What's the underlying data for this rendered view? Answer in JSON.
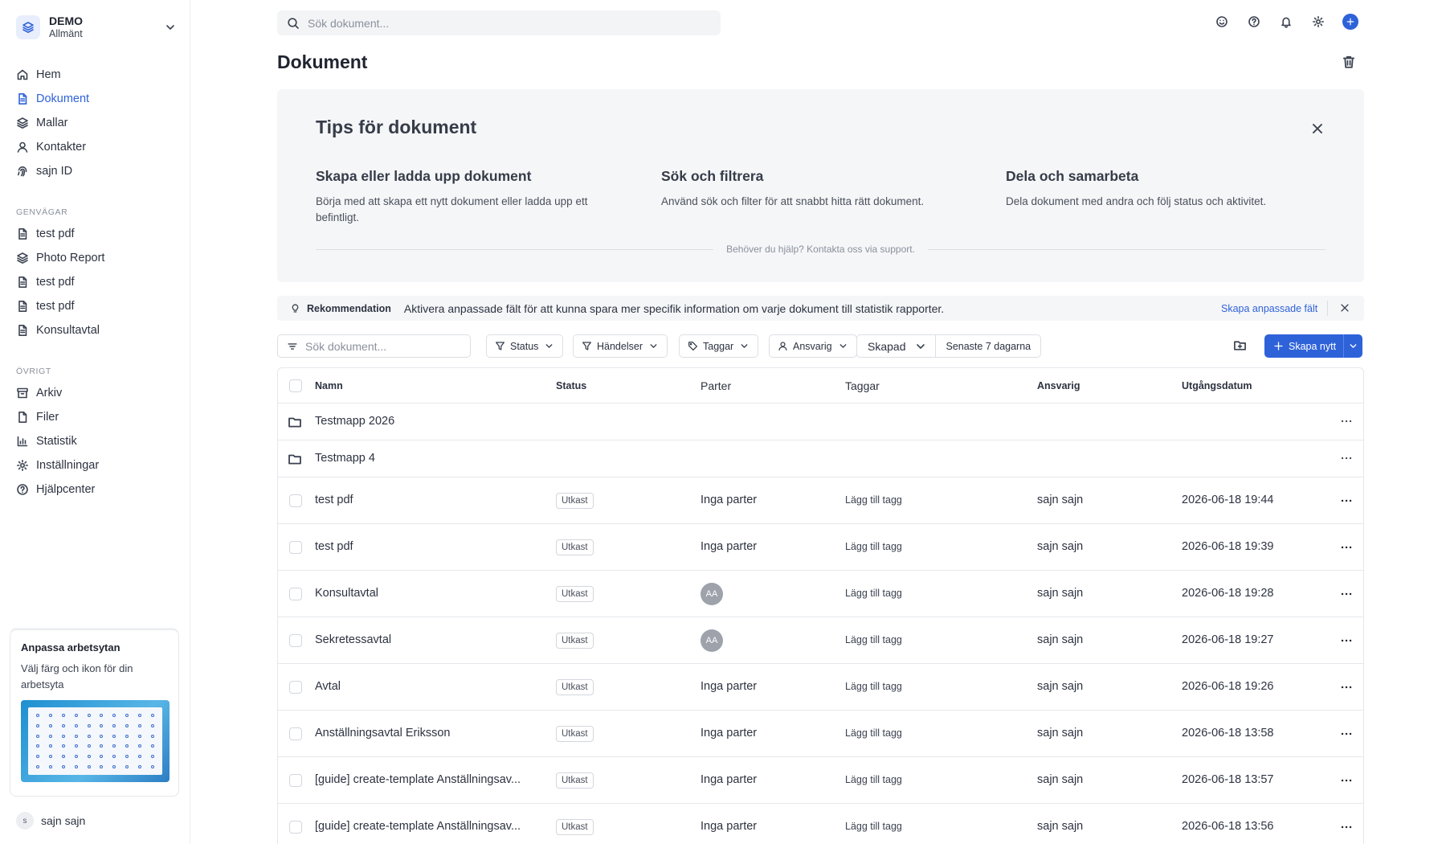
{
  "workspace": {
    "name": "DEMO",
    "subtitle": "Allmänt"
  },
  "nav": [
    {
      "label": "Hem",
      "icon": "home-icon",
      "active": false
    },
    {
      "label": "Dokument",
      "icon": "document-icon",
      "active": true
    },
    {
      "label": "Mallar",
      "icon": "layers-icon",
      "active": false
    },
    {
      "label": "Kontakter",
      "icon": "user-icon",
      "active": false
    },
    {
      "label": "sajn ID",
      "icon": "fingerprint-icon",
      "active": false
    }
  ],
  "shortcuts": {
    "label": "GENVÄGAR",
    "items": [
      {
        "label": "test pdf",
        "icon": "document-icon"
      },
      {
        "label": "Photo Report",
        "icon": "layers-icon"
      },
      {
        "label": "test pdf",
        "icon": "document-icon"
      },
      {
        "label": "test pdf",
        "icon": "document-icon"
      },
      {
        "label": "Konsultavtal",
        "icon": "document-icon"
      }
    ]
  },
  "other": {
    "label": "ÖVRIGT",
    "items": [
      {
        "label": "Arkiv",
        "icon": "archive-icon"
      },
      {
        "label": "Filer",
        "icon": "file-icon"
      },
      {
        "label": "Statistik",
        "icon": "chart-icon"
      },
      {
        "label": "Inställningar",
        "icon": "gear-icon"
      },
      {
        "label": "Hjälpcenter",
        "icon": "help-icon"
      }
    ]
  },
  "promo": {
    "title": "Anpassa arbetsytan",
    "description": "Välj färg och ikon för din arbetsyta"
  },
  "user": {
    "initial": "s",
    "name": "sajn sajn"
  },
  "topbar": {
    "search_placeholder": "Sök dokument..."
  },
  "page": {
    "title": "Dokument"
  },
  "tips": {
    "title": "Tips för dokument",
    "items": [
      {
        "heading": "Skapa eller ladda upp dokument",
        "text": "Börja med att skapa ett nytt dokument eller ladda upp ett befintligt."
      },
      {
        "heading": "Sök och filtrera",
        "text": "Använd sök och filter för att snabbt hitta rätt dokument."
      },
      {
        "heading": "Dela och samarbeta",
        "text": "Dela dokument med andra och följ status och aktivitet."
      }
    ],
    "help": "Behöver du hjälp? Kontakta oss via support."
  },
  "recommendation": {
    "label": "Rekommendation",
    "text": "Aktivera anpassade fält för att kunna spara mer specifik information om varje dokument till statistik rapporter.",
    "link": "Skapa anpassade fält"
  },
  "filters": {
    "search_placeholder": "Sök dokument...",
    "status": "Status",
    "events": "Händelser",
    "tags": "Taggar",
    "owner": "Ansvarig",
    "date_field": "Skapad",
    "date_range": "Senaste 7 dagarna",
    "create": "Skapa nytt"
  },
  "table": {
    "columns": {
      "name": "Namn",
      "status": "Status",
      "parties": "Parter",
      "tags": "Taggar",
      "owner": "Ansvarig",
      "expiry": "Utgångsdatum"
    },
    "folders": [
      {
        "name": "Testmapp 2026"
      },
      {
        "name": "Testmapp 4"
      }
    ],
    "rows": [
      {
        "name": "test pdf",
        "status": "Utkast",
        "parties": "Inga parter",
        "tags": "Lägg till tagg",
        "owner": "sajn sajn",
        "date": "2026-06-18 19:44"
      },
      {
        "name": "test pdf",
        "status": "Utkast",
        "parties": "Inga parter",
        "tags": "Lägg till tagg",
        "owner": "sajn sajn",
        "date": "2026-06-18 19:39"
      },
      {
        "name": "Konsultavtal",
        "status": "Utkast",
        "avatar": "AA",
        "tags": "Lägg till tagg",
        "owner": "sajn sajn",
        "date": "2026-06-18 19:28"
      },
      {
        "name": "Sekretessavtal",
        "status": "Utkast",
        "avatar": "AA",
        "tags": "Lägg till tagg",
        "owner": "sajn sajn",
        "date": "2026-06-18 19:27"
      },
      {
        "name": "Avtal",
        "status": "Utkast",
        "parties": "Inga parter",
        "tags": "Lägg till tagg",
        "owner": "sajn sajn",
        "date": "2026-06-18 19:26"
      },
      {
        "name": "Anställningsavtal Eriksson",
        "status": "Utkast",
        "parties": "Inga parter",
        "tags": "Lägg till tagg",
        "owner": "sajn sajn",
        "date": "2026-06-18 13:58"
      },
      {
        "name": "[guide] create-template Anställningsav...",
        "status": "Utkast",
        "parties": "Inga parter",
        "tags": "Lägg till tagg",
        "owner": "sajn sajn",
        "date": "2026-06-18 13:57"
      },
      {
        "name": "[guide] create-template Anställningsav...",
        "status": "Utkast",
        "parties": "Inga parter",
        "tags": "Lägg till tagg",
        "owner": "sajn sajn",
        "date": "2026-06-18 13:56"
      }
    ]
  },
  "colors": {
    "accent": "#2e62d9",
    "text": "#1f2430",
    "muted": "#8a909c",
    "panel": "#f5f6f8",
    "border": "#e6e8ec"
  }
}
